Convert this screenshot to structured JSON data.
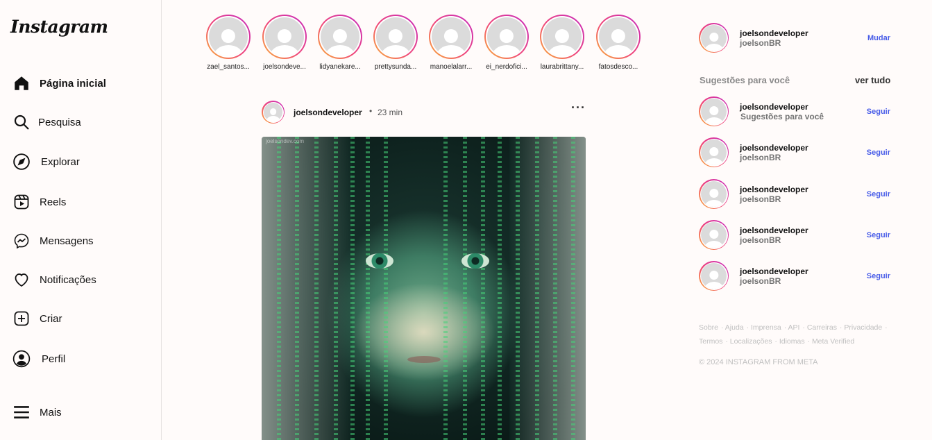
{
  "app": {
    "logo": "Instagram"
  },
  "nav": [
    {
      "label": "Página inicial",
      "icon": "home-icon",
      "active": true
    },
    {
      "label": "Pesquisa",
      "icon": "search-icon"
    },
    {
      "label": "Explorar",
      "icon": "compass-icon"
    },
    {
      "label": "Reels",
      "icon": "reels-icon"
    },
    {
      "label": "Mensagens",
      "icon": "messenger-icon"
    },
    {
      "label": "Notificações",
      "icon": "heart-icon"
    },
    {
      "label": "Criar",
      "icon": "plus-square-icon"
    },
    {
      "label": "Perfil",
      "icon": "profile-icon"
    },
    {
      "label": "Mais",
      "icon": "menu-icon"
    }
  ],
  "stories": [
    {
      "name": "zael_santos..."
    },
    {
      "name": "joelsondeve..."
    },
    {
      "name": "lidyanekare..."
    },
    {
      "name": "prettysunda..."
    },
    {
      "name": "manoelalarr..."
    },
    {
      "name": "ei_nerdofici..."
    },
    {
      "name": "laurabrittany..."
    },
    {
      "name": "fatosdesco..."
    }
  ],
  "post": {
    "username": "joelsondeveloper",
    "separator": "•",
    "time": "23 min",
    "more": "···",
    "watermark": "joelsondev.com"
  },
  "current_user": {
    "username": "joelsondeveloper",
    "name": "joelsonBR",
    "action": "Mudar"
  },
  "suggestions": {
    "title": "Sugestões para você",
    "see_all": "ver tudo",
    "items": [
      {
        "username": "joelsondeveloper",
        "sub": "Sugestões para você",
        "action": "Seguir"
      },
      {
        "username": "joelsondeveloper",
        "sub": "joelsonBR",
        "action": "Seguir"
      },
      {
        "username": "joelsondeveloper",
        "sub": "joelsonBR",
        "action": "Seguir"
      },
      {
        "username": "joelsondeveloper",
        "sub": "joelsonBR",
        "action": "Seguir"
      },
      {
        "username": "joelsondeveloper",
        "sub": "joelsonBR",
        "action": "Seguir"
      }
    ]
  },
  "footer": {
    "links_line1": [
      "Sobre",
      "Ajuda",
      "Imprensa",
      "API",
      "Carreiras",
      "Privacidade"
    ],
    "links_line2": [
      "Termos",
      "Localizações",
      "Idiomas",
      "Meta Verified"
    ],
    "copyright": "© 2024 INSTAGRAM FROM META"
  },
  "colors": {
    "accent": "#4a5ee8",
    "background": "#fffbfa"
  }
}
